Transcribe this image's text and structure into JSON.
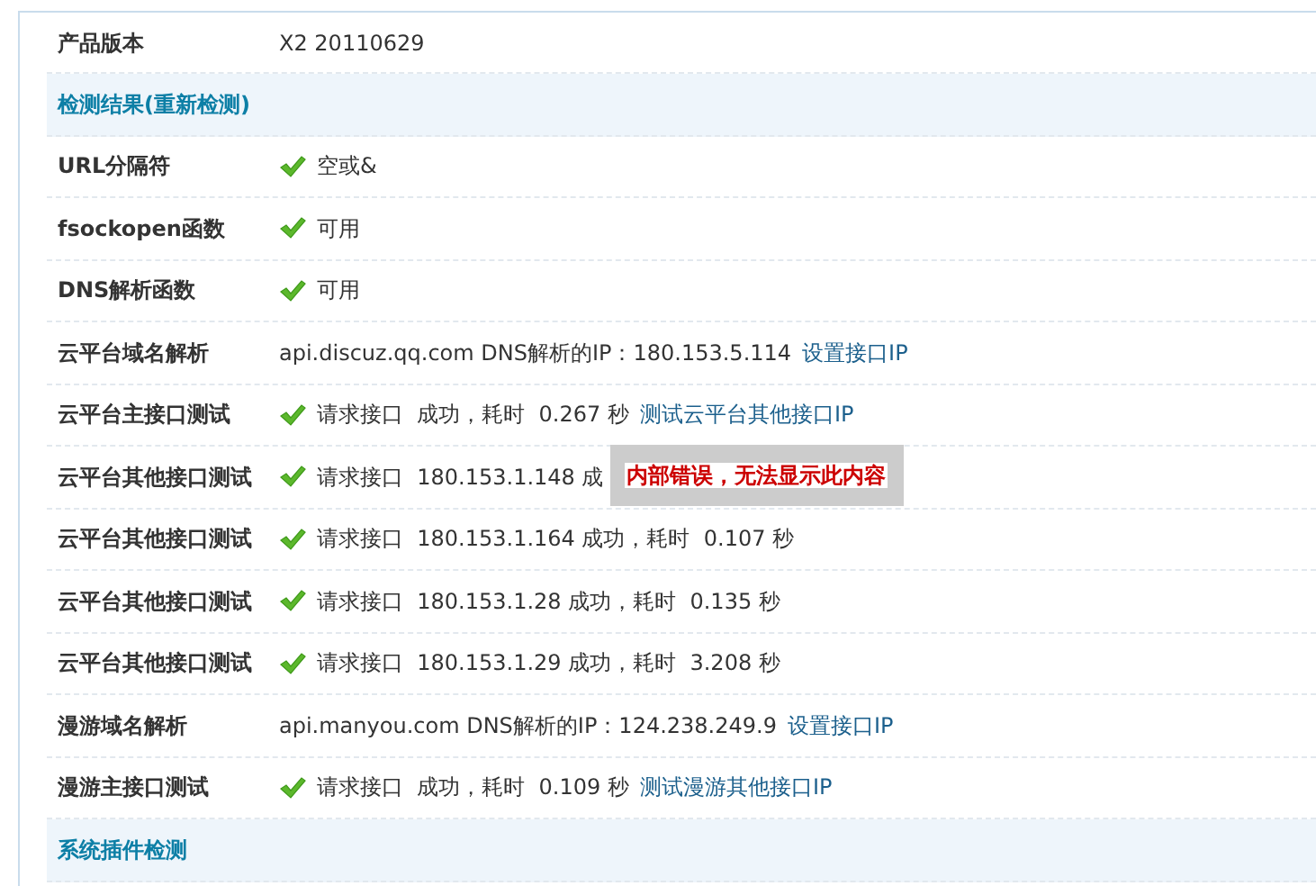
{
  "rows": [
    {
      "kind": "row",
      "label": "产品版本",
      "ok": false,
      "value": "X2 20110629"
    },
    {
      "kind": "section",
      "label": "检测结果(重新检测)"
    },
    {
      "kind": "row",
      "label": "URL分隔符",
      "ok": true,
      "value": "空或&"
    },
    {
      "kind": "row",
      "label": "fsockopen函数",
      "ok": true,
      "value": "可用"
    },
    {
      "kind": "row",
      "label": "DNS解析函数",
      "ok": true,
      "value": "可用"
    },
    {
      "kind": "row",
      "label": "云平台域名解析",
      "ok": false,
      "value": "api.discuz.qq.com DNS解析的IP：180.153.5.114",
      "link": "设置接口IP"
    },
    {
      "kind": "row",
      "label": "云平台主接口测试",
      "ok": true,
      "value": "请求接口  成功，耗时  0.267 秒",
      "link": "测试云平台其他接口IP"
    },
    {
      "kind": "row",
      "label": "云平台其他接口测试",
      "ok": true,
      "value": "请求接口  180.153.1.148 成",
      "popup": "内部错误，无法显示此内容"
    },
    {
      "kind": "row",
      "label": "云平台其他接口测试",
      "ok": true,
      "value": "请求接口  180.153.1.164 成功，耗时  0.107 秒"
    },
    {
      "kind": "row",
      "label": "云平台其他接口测试",
      "ok": true,
      "value": "请求接口  180.153.1.28 成功，耗时  0.135 秒"
    },
    {
      "kind": "row",
      "label": "云平台其他接口测试",
      "ok": true,
      "value": "请求接口  180.153.1.29 成功，耗时  3.208 秒"
    },
    {
      "kind": "row",
      "label": "漫游域名解析",
      "ok": false,
      "value": "api.manyou.com DNS解析的IP：124.238.249.9",
      "link": "设置接口IP"
    },
    {
      "kind": "row",
      "label": "漫游主接口测试",
      "ok": true,
      "value": "请求接口  成功，耗时  0.109 秒",
      "link": "测试漫游其他接口IP"
    },
    {
      "kind": "section",
      "label": "系统插件检测"
    }
  ]
}
